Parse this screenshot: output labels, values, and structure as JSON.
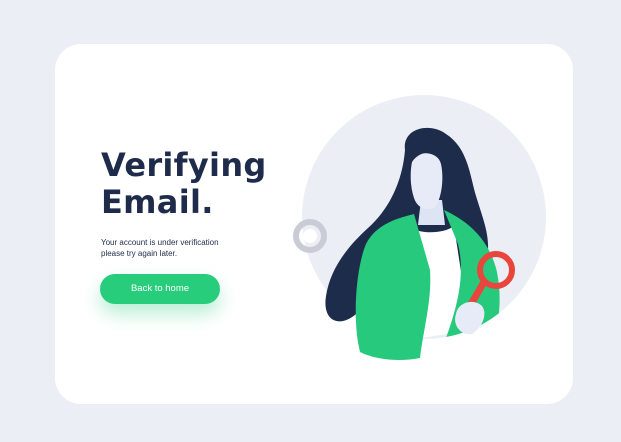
{
  "heading": {
    "line1": "Verifying",
    "line2": "Email."
  },
  "message": {
    "line1": "Your account is under verification",
    "line2": "please try again later."
  },
  "actions": {
    "back_home_label": "Back to home"
  },
  "colors": {
    "background": "#eceef5",
    "card": "#ffffff",
    "heading_text": "#1f2b4a",
    "button_accent": "#28cd7c",
    "jacket": "#27c97d",
    "hair": "#1e2c4c",
    "magnifier": "#e8453c"
  },
  "icons": {
    "illustration": "woman-with-magnifying-glass",
    "loader": "loading-ring-icon"
  }
}
